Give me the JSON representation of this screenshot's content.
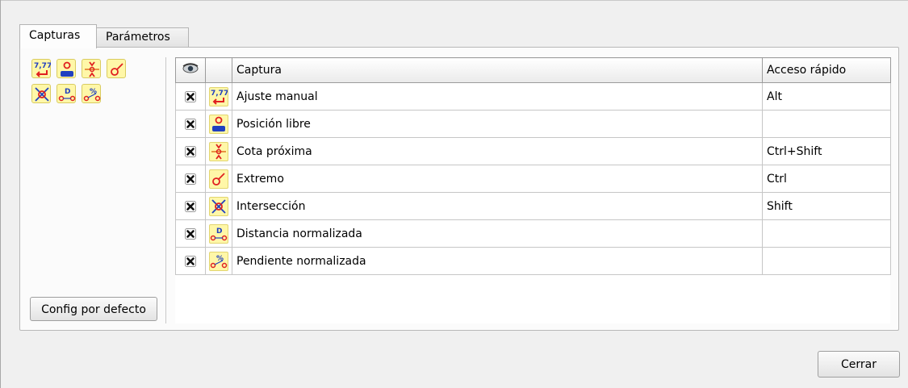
{
  "tabs": [
    {
      "label": "Capturas",
      "active": true
    },
    {
      "label": "Parámetros",
      "active": false
    }
  ],
  "tool_icons": [
    "manual-adjust-icon",
    "free-position-icon",
    "nearest-dimension-icon",
    "endpoint-icon",
    "intersection-icon",
    "normalized-distance-icon",
    "normalized-slope-icon"
  ],
  "default_button": "Config por defecto",
  "close_button": "Cerrar",
  "table": {
    "headers": {
      "visibility": "eye-icon",
      "icon": "",
      "capture": "Captura",
      "shortcut": "Acceso rápido"
    },
    "rows": [
      {
        "checked": true,
        "icon": "manual-adjust-icon",
        "capture": "Ajuste manual",
        "shortcut": "Alt"
      },
      {
        "checked": true,
        "icon": "free-position-icon",
        "capture": "Posición libre",
        "shortcut": ""
      },
      {
        "checked": true,
        "icon": "nearest-dimension-icon",
        "capture": "Cota próxima",
        "shortcut": "Ctrl+Shift"
      },
      {
        "checked": true,
        "icon": "endpoint-icon",
        "capture": "Extremo",
        "shortcut": "Ctrl"
      },
      {
        "checked": true,
        "icon": "intersection-icon",
        "capture": "Intersección",
        "shortcut": "Shift"
      },
      {
        "checked": true,
        "icon": "normalized-distance-icon",
        "capture": "Distancia normalizada",
        "shortcut": ""
      },
      {
        "checked": true,
        "icon": "normalized-slope-icon",
        "capture": "Pendiente normalizada",
        "shortcut": ""
      }
    ]
  },
  "colors": {
    "icon_bg": "#fff7a8",
    "icon_red": "#e02020",
    "icon_blue": "#2040c0"
  }
}
